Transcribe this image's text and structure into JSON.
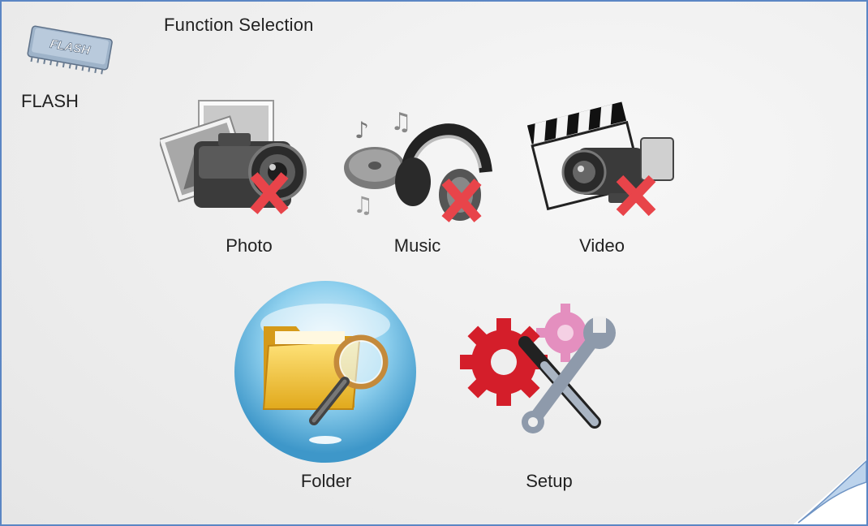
{
  "header": {
    "title": "Function Selection"
  },
  "device": {
    "chip_text": "FLASH",
    "label": "FLASH"
  },
  "menu": {
    "photo": {
      "label": "Photo",
      "icon": "camera-icon",
      "unavailable": true
    },
    "music": {
      "label": "Music",
      "icon": "headphones-icon",
      "unavailable": true
    },
    "video": {
      "label": "Video",
      "icon": "camcorder-icon",
      "unavailable": true
    },
    "folder": {
      "label": "Folder",
      "icon": "folder-search-icon",
      "selected": true
    },
    "setup": {
      "label": "Setup",
      "icon": "gears-tools-icon"
    }
  },
  "colors": {
    "frame_border": "#5b86c4",
    "unavailable_mark": "#e8444a",
    "selected_halo": "#4a9fd0"
  }
}
